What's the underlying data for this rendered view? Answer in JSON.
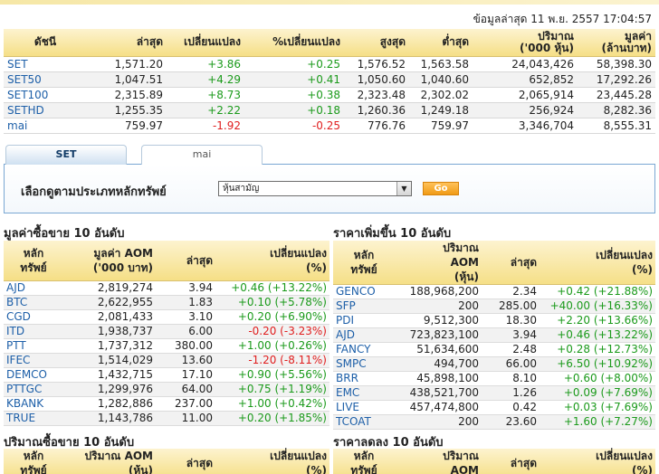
{
  "timestamp": "ข้อมูลล่าสุด 11 พ.ย. 2557 17:04:57",
  "index_table": {
    "headers": [
      "ดัชนี",
      "ล่าสุด",
      "เปลี่ยนแปลง",
      "%เปลี่ยนแปลง",
      "สูงสุด",
      "ต่ำสุด",
      "ปริมาณ\n('000 หุ้น)",
      "มูลค่า\n(ล้านบาท)"
    ],
    "rows": [
      {
        "name": "SET",
        "last": "1,571.20",
        "chg": "+3.86",
        "pchg": "+0.25",
        "high": "1,576.52",
        "low": "1,563.58",
        "vol": "24,043,426",
        "val": "58,398.30",
        "dir": "pos"
      },
      {
        "name": "SET50",
        "last": "1,047.51",
        "chg": "+4.29",
        "pchg": "+0.41",
        "high": "1,050.60",
        "low": "1,040.60",
        "vol": "652,852",
        "val": "17,292.26",
        "dir": "pos"
      },
      {
        "name": "SET100",
        "last": "2,315.89",
        "chg": "+8.73",
        "pchg": "+0.38",
        "high": "2,323.48",
        "low": "2,302.02",
        "vol": "2,065,914",
        "val": "23,445.28",
        "dir": "pos"
      },
      {
        "name": "SETHD",
        "last": "1,255.35",
        "chg": "+2.22",
        "pchg": "+0.18",
        "high": "1,260.36",
        "low": "1,249.18",
        "vol": "256,924",
        "val": "8,282.36",
        "dir": "pos"
      },
      {
        "name": "mai",
        "last": "759.97",
        "chg": "-1.92",
        "pchg": "-0.25",
        "high": "776.76",
        "low": "759.97",
        "vol": "3,346,704",
        "val": "8,555.31",
        "dir": "neg"
      }
    ]
  },
  "tabs": [
    {
      "label": "SET",
      "active": true
    },
    {
      "label": "mai",
      "active": false
    }
  ],
  "filter": {
    "label": "เลือกดูตามประเภทหลักทรัพย์",
    "selected": "หุ้นสามัญ",
    "go_label": "Go"
  },
  "top_value": {
    "title": "มูลค่าซื้อขาย 10 อันดับ",
    "headers": [
      "หลัก\nทรัพย์",
      "มูลค่า AOM\n('000 บาท)",
      "ล่าสุด",
      "เปลี่ยนแปลง\n(%)"
    ],
    "rows": [
      {
        "sym": "AJD",
        "v": "2,819,274",
        "last": "3.94",
        "chg": "+0.46 (+13.22%)",
        "dir": "pos"
      },
      {
        "sym": "BTC",
        "v": "2,622,955",
        "last": "1.83",
        "chg": "+0.10 (+5.78%)",
        "dir": "pos"
      },
      {
        "sym": "CGD",
        "v": "2,081,433",
        "last": "3.10",
        "chg": "+0.20 (+6.90%)",
        "dir": "pos"
      },
      {
        "sym": "ITD",
        "v": "1,938,737",
        "last": "6.00",
        "chg": "-0.20 (-3.23%)",
        "dir": "neg"
      },
      {
        "sym": "PTT",
        "v": "1,737,312",
        "last": "380.00",
        "chg": "+1.00 (+0.26%)",
        "dir": "pos"
      },
      {
        "sym": "IFEC",
        "v": "1,514,029",
        "last": "13.60",
        "chg": "-1.20 (-8.11%)",
        "dir": "neg"
      },
      {
        "sym": "DEMCO",
        "v": "1,432,715",
        "last": "17.10",
        "chg": "+0.90 (+5.56%)",
        "dir": "pos"
      },
      {
        "sym": "PTTGC",
        "v": "1,299,976",
        "last": "64.00",
        "chg": "+0.75 (+1.19%)",
        "dir": "pos"
      },
      {
        "sym": "KBANK",
        "v": "1,282,886",
        "last": "237.00",
        "chg": "+1.00 (+0.42%)",
        "dir": "pos"
      },
      {
        "sym": "TRUE",
        "v": "1,143,786",
        "last": "11.00",
        "chg": "+0.20 (+1.85%)",
        "dir": "pos"
      }
    ]
  },
  "top_gainers": {
    "title": "ราคาเพิ่มขึ้น 10 อันดับ",
    "headers": [
      "หลัก\nทรัพย์",
      "ปริมาณ\nAOM\n(หุ้น)",
      "ล่าสุด",
      "เปลี่ยนแปลง\n(%)"
    ],
    "rows": [
      {
        "sym": "GENCO",
        "v": "188,968,200",
        "last": "2.34",
        "chg": "+0.42 (+21.88%)",
        "dir": "pos"
      },
      {
        "sym": "SFP",
        "v": "200",
        "last": "285.00",
        "chg": "+40.00 (+16.33%)",
        "dir": "pos"
      },
      {
        "sym": "PDI",
        "v": "9,512,300",
        "last": "18.30",
        "chg": "+2.20 (+13.66%)",
        "dir": "pos"
      },
      {
        "sym": "AJD",
        "v": "723,823,100",
        "last": "3.94",
        "chg": "+0.46 (+13.22%)",
        "dir": "pos"
      },
      {
        "sym": "FANCY",
        "v": "51,634,600",
        "last": "2.48",
        "chg": "+0.28 (+12.73%)",
        "dir": "pos"
      },
      {
        "sym": "SMPC",
        "v": "494,700",
        "last": "66.00",
        "chg": "+6.50 (+10.92%)",
        "dir": "pos"
      },
      {
        "sym": "BRR",
        "v": "45,898,100",
        "last": "8.10",
        "chg": "+0.60 (+8.00%)",
        "dir": "pos"
      },
      {
        "sym": "EMC",
        "v": "438,521,700",
        "last": "1.26",
        "chg": "+0.09 (+7.69%)",
        "dir": "pos"
      },
      {
        "sym": "LIVE",
        "v": "457,474,800",
        "last": "0.42",
        "chg": "+0.03 (+7.69%)",
        "dir": "pos"
      },
      {
        "sym": "TCOAT",
        "v": "200",
        "last": "23.60",
        "chg": "+1.60 (+7.27%)",
        "dir": "pos"
      }
    ]
  },
  "top_volume": {
    "title": "ปริมาณซื้อขาย 10 อันดับ",
    "headers": [
      "หลัก\nทรัพย์",
      "ปริมาณ AOM\n(หุ้น)",
      "ล่าสุด",
      "เปลี่ยนแปลง\n(%)"
    ]
  },
  "top_losers": {
    "title": "ราคาลดลง 10 อันดับ",
    "headers": [
      "หลัก\nทรัพย์",
      "ปริมาณ\nAOM",
      "ล่าสุด",
      "เปลี่ยนแปลง\n(%)"
    ]
  }
}
